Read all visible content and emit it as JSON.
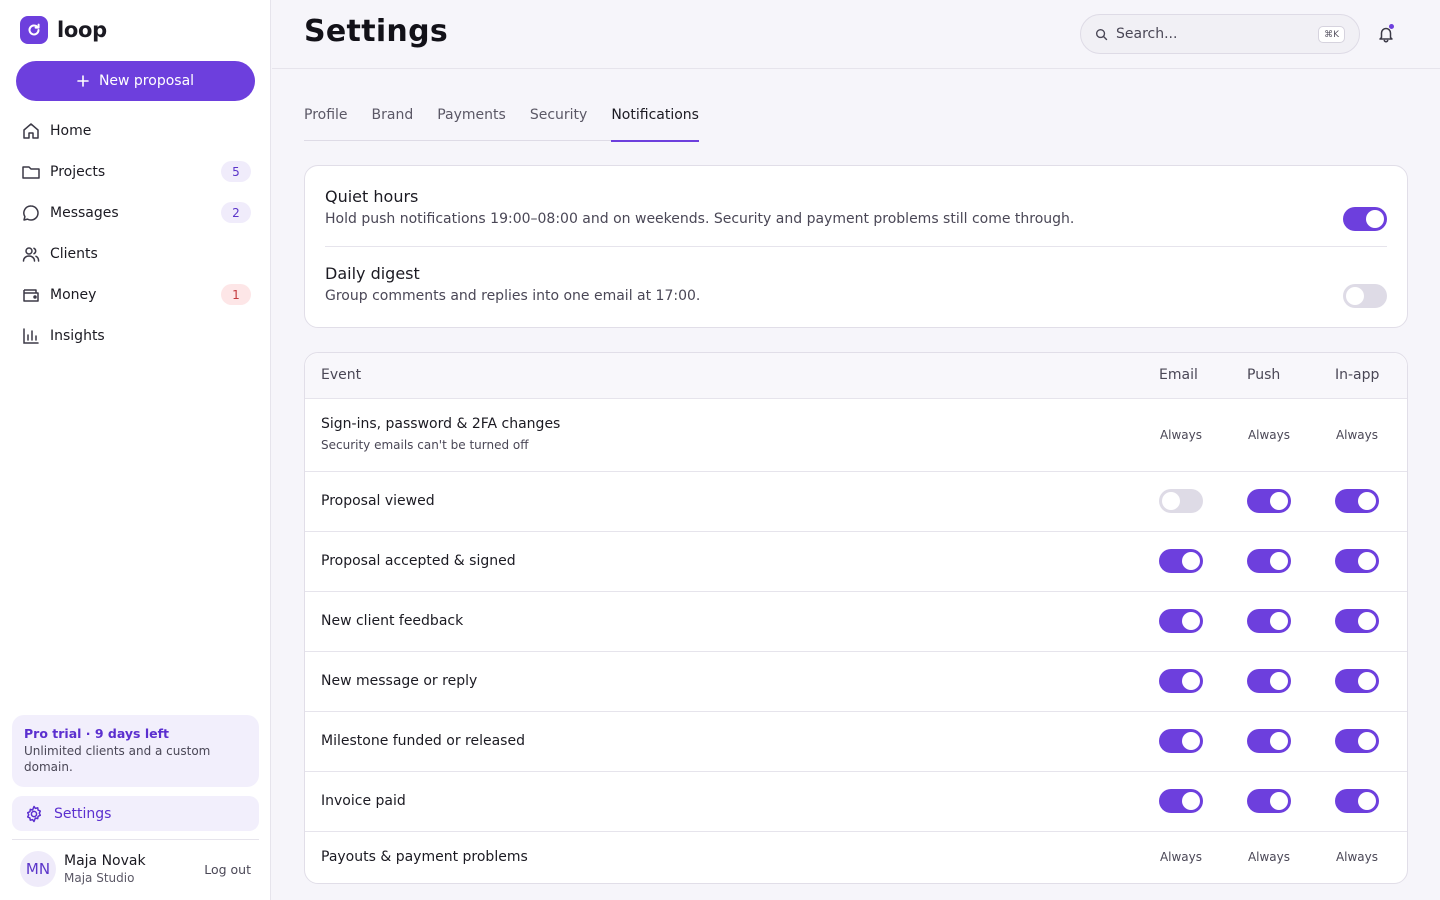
{
  "app": {
    "name": "loop",
    "brand_color": "#6d3fdd"
  },
  "sidebar": {
    "new_button": "New proposal",
    "items": [
      {
        "label": "Home",
        "icon": "home-icon",
        "badge": ""
      },
      {
        "label": "Projects",
        "icon": "folder-icon",
        "badge": "5"
      },
      {
        "label": "Messages",
        "icon": "message-icon",
        "badge": "2"
      },
      {
        "label": "Clients",
        "icon": "users-icon",
        "badge": ""
      },
      {
        "label": "Money",
        "icon": "wallet-icon",
        "badge": "1"
      },
      {
        "label": "Insights",
        "icon": "chart-icon",
        "badge": ""
      }
    ],
    "trial": {
      "title": "Pro trial · 9 days left",
      "desc": "Unlimited clients and a custom domain."
    },
    "settings_label": "Settings",
    "user": {
      "initials": "MN",
      "name": "Maja Novak",
      "org": "Maja Studio",
      "logout": "Log out"
    }
  },
  "header": {
    "title": "Settings",
    "search_placeholder": "Search...",
    "shortcut": "⌘K"
  },
  "tabs": [
    "Profile",
    "Brand",
    "Payments",
    "Security",
    "Notifications"
  ],
  "active_tab": "Notifications",
  "prefs": [
    {
      "title": "Quiet hours",
      "desc": "Hold push notifications 19:00–08:00 and on weekends. Security and payment problems still come through.",
      "on": true
    },
    {
      "title": "Daily digest",
      "desc": "Group comments and replies into one email at 17:00.",
      "on": false
    }
  ],
  "table": {
    "columns": [
      "Event",
      "Email",
      "Push",
      "In-app"
    ],
    "always_label": "Always",
    "rows": [
      {
        "event": "Sign-ins, password & 2FA changes",
        "sub": "Security emails can't be turned off",
        "email": "Always",
        "push": "Always",
        "inapp": "Always"
      },
      {
        "event": "Proposal viewed",
        "email": false,
        "push": true,
        "inapp": true
      },
      {
        "event": "Proposal accepted & signed",
        "email": true,
        "push": true,
        "inapp": true
      },
      {
        "event": "New client feedback",
        "email": true,
        "push": true,
        "inapp": true
      },
      {
        "event": "New message or reply",
        "email": true,
        "push": true,
        "inapp": true
      },
      {
        "event": "Milestone funded or released",
        "email": true,
        "push": true,
        "inapp": true
      },
      {
        "event": "Invoice paid",
        "email": true,
        "push": true,
        "inapp": true
      },
      {
        "event": "Payouts & payment problems",
        "email": "Always",
        "push": "Always",
        "inapp": "Always"
      }
    ]
  }
}
